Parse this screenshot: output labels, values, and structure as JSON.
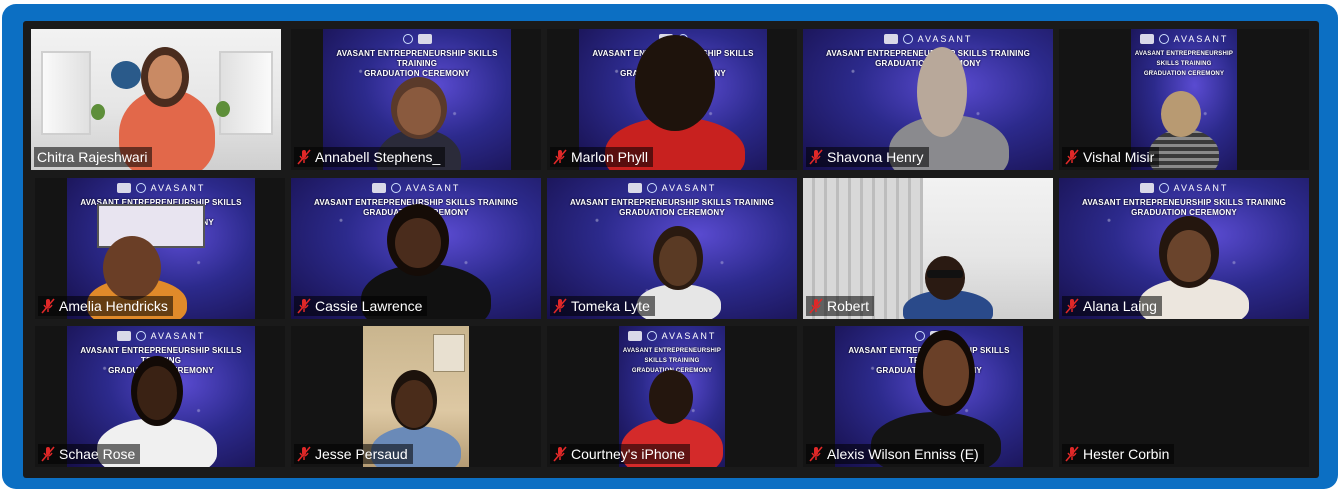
{
  "banner": {
    "brand": "AVASANT",
    "line1": "AVASANT ENTREPRENEURSHIP SKILLS TRAINING",
    "line2": "GRADUATION CEREMONY"
  },
  "participants": [
    {
      "name": "Chitra Rajeshwari",
      "muted": false,
      "active": true
    },
    {
      "name": "Annabell Stephens_",
      "muted": true
    },
    {
      "name": "Marlon Phyll",
      "muted": true
    },
    {
      "name": "Shavona Henry",
      "muted": true
    },
    {
      "name": "Vishal Misir",
      "muted": true
    },
    {
      "name": "Amelia  Hendricks",
      "muted": true
    },
    {
      "name": "Cassie Lawrence",
      "muted": true
    },
    {
      "name": "Tomeka Lyte",
      "muted": true
    },
    {
      "name": "Robert",
      "muted": true
    },
    {
      "name": "Alana Laing",
      "muted": true
    },
    {
      "name": "Schae Rose",
      "muted": true
    },
    {
      "name": "Jesse Persaud",
      "muted": true
    },
    {
      "name": "Courtney's iPhone",
      "muted": true
    },
    {
      "name": "Alexis Wilson Enniss (E)",
      "muted": true
    },
    {
      "name": "Hester Corbin",
      "muted": true
    }
  ],
  "colors": {
    "frame": "#0c6fc3",
    "active_border": "#c8e05a",
    "muted_icon": "#e02828"
  }
}
